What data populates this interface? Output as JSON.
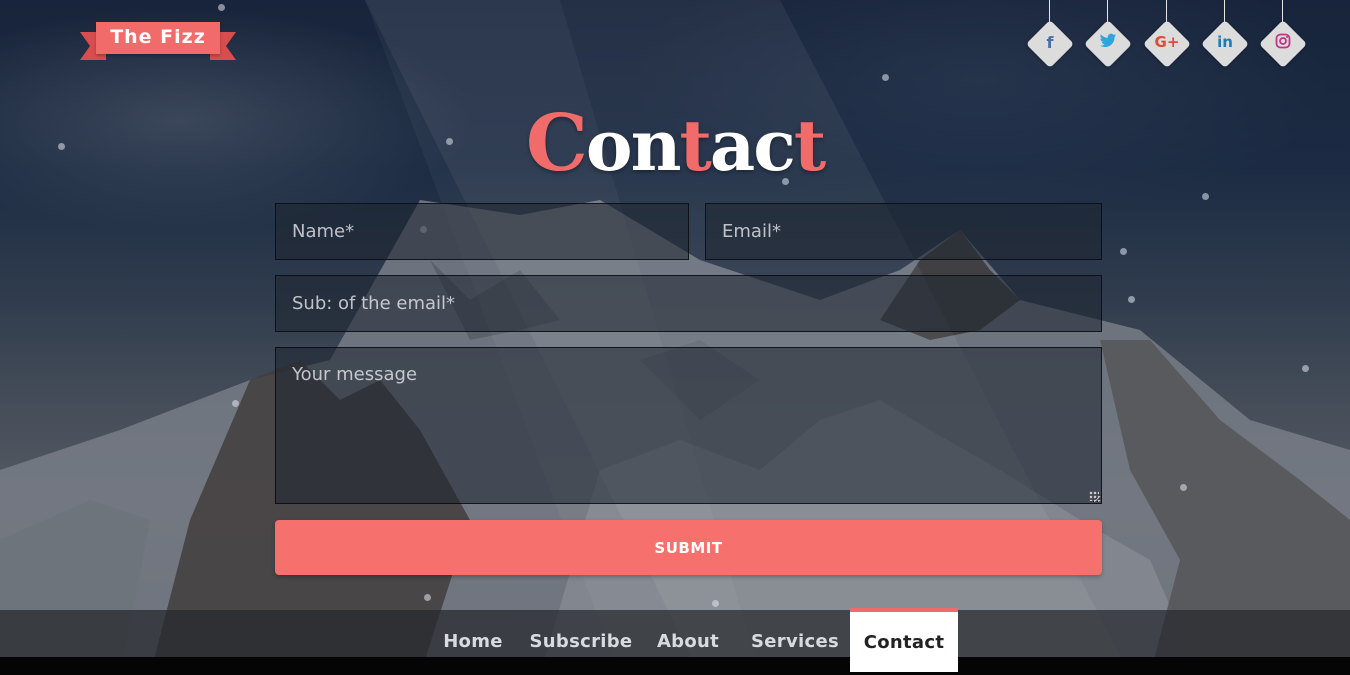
{
  "brand": {
    "name": "The Fizz",
    "accent": "#f26b6b"
  },
  "social": [
    {
      "icon": "facebook-icon",
      "glyph": "f",
      "color": "#4a6fa8"
    },
    {
      "icon": "twitter-icon",
      "glyph": "🐦",
      "color": "#2fa5e0"
    },
    {
      "icon": "google-plus-icon",
      "glyph": "G+",
      "color": "#dd4b39"
    },
    {
      "icon": "linkedin-icon",
      "glyph": "in",
      "color": "#1d7bb8"
    },
    {
      "icon": "instagram-icon",
      "glyph": "◎",
      "color": "#c13584"
    }
  ],
  "page": {
    "title": "Contact"
  },
  "form": {
    "name_placeholder": "Name*",
    "email_placeholder": "Email*",
    "subject_placeholder": "Sub: of the email*",
    "message_placeholder": "Your message",
    "submit_label": "SUBMIT"
  },
  "nav": {
    "items": [
      {
        "label": "Home"
      },
      {
        "label": "Subscribe"
      },
      {
        "label": "About"
      },
      {
        "label": "Services"
      },
      {
        "label": "Contact",
        "active": true
      }
    ]
  }
}
